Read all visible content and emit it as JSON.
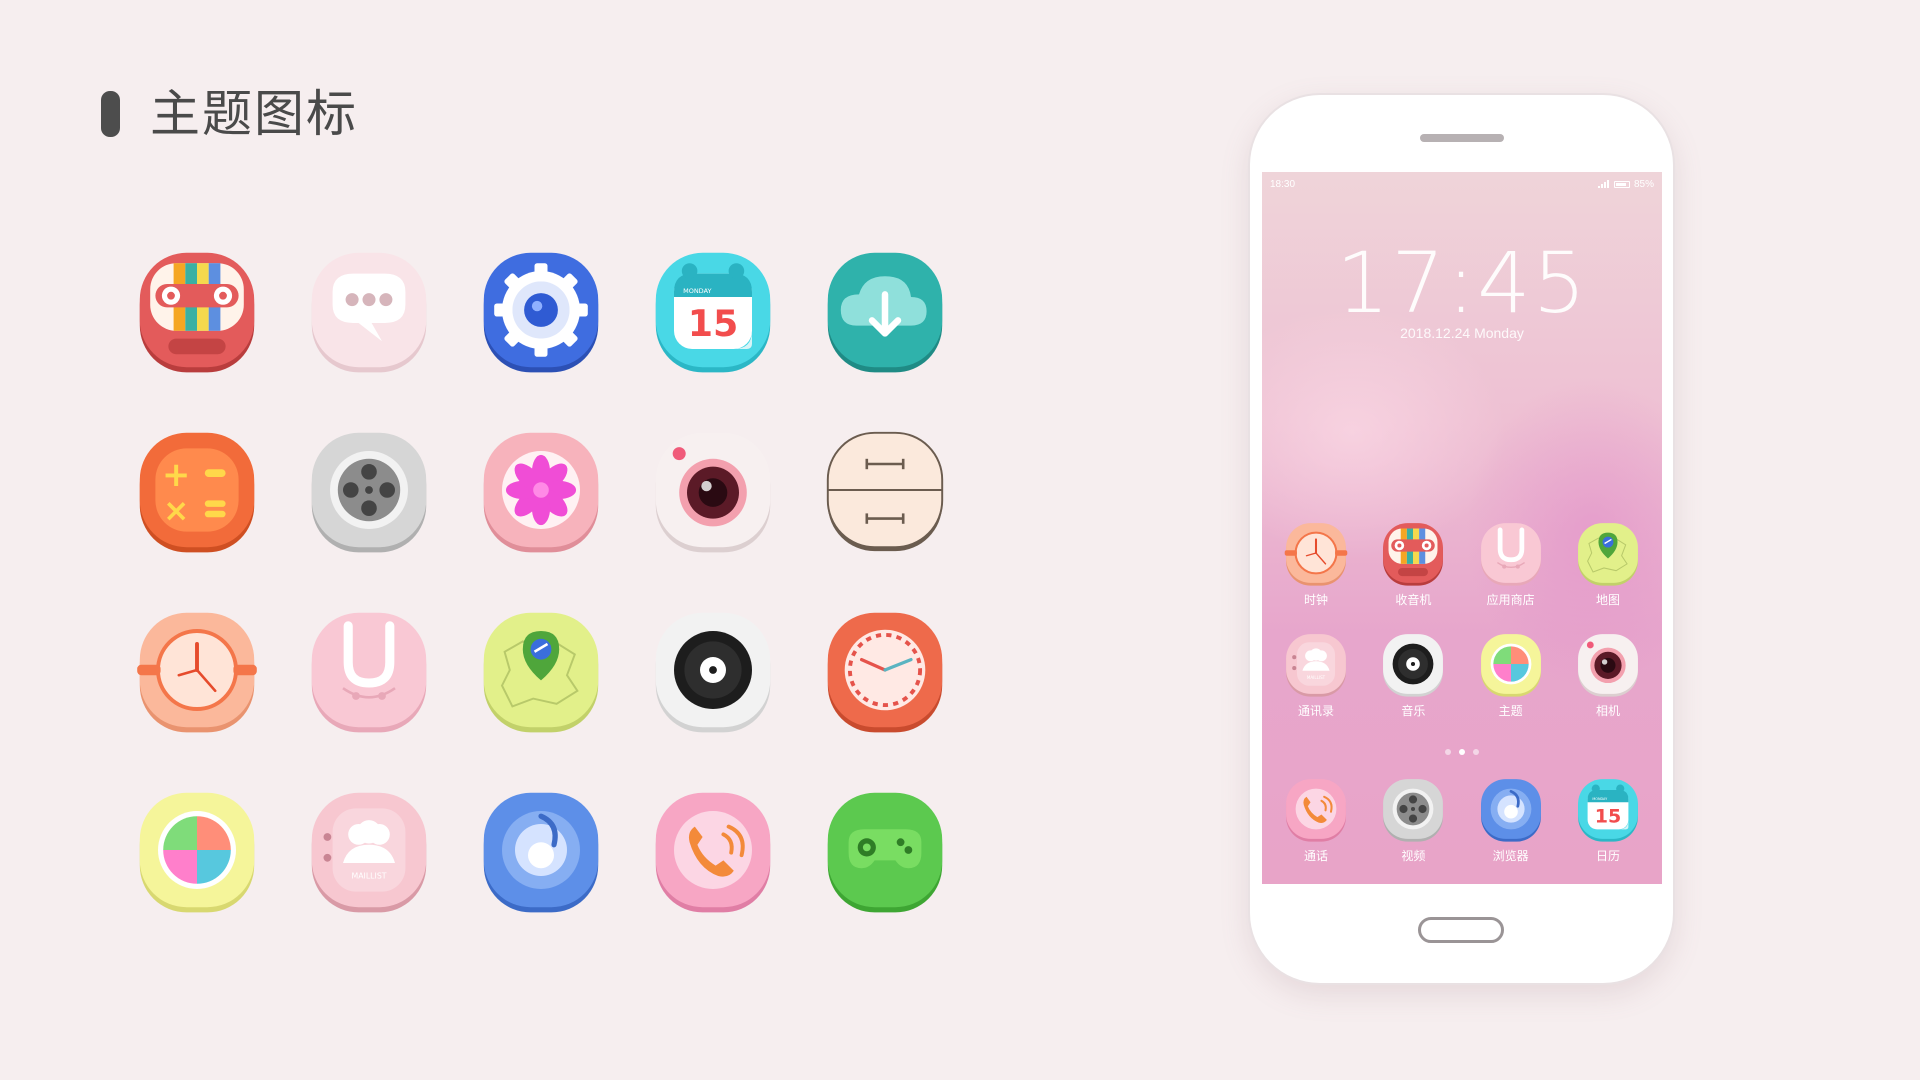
{
  "header": {
    "title": "主题图标"
  },
  "icon_grid": [
    "radio-icon",
    "messages-icon",
    "settings-icon",
    "calendar-icon",
    "cloud-download-icon",
    "calculator-icon",
    "video-icon",
    "gallery-icon",
    "camera-icon",
    "file-manager-icon",
    "clock-icon",
    "app-store-icon",
    "map-icon",
    "music-icon",
    "alarm-icon",
    "theme-icon",
    "contacts-icon",
    "browser-icon",
    "phone-call-icon",
    "game-icon"
  ],
  "calendar_icon": {
    "month_label": "MONDAY",
    "day": "15"
  },
  "contacts_icon": {
    "label": "MAILLIST"
  },
  "phone": {
    "status": {
      "time": "18:30",
      "battery": "85%"
    },
    "lock_time": "17:45",
    "lock_date": "2018.12.24  Monday",
    "page_dots": [
      false,
      true,
      false
    ],
    "rows": [
      [
        {
          "icon": "clock-icon",
          "label": "时钟"
        },
        {
          "icon": "radio-icon",
          "label": "收音机"
        },
        {
          "icon": "app-store-icon",
          "label": "应用商店"
        },
        {
          "icon": "map-icon",
          "label": "地图"
        }
      ],
      [
        {
          "icon": "contacts-icon",
          "label": "通讯录"
        },
        {
          "icon": "music-icon",
          "label": "音乐"
        },
        {
          "icon": "theme-icon",
          "label": "主题"
        },
        {
          "icon": "camera-icon",
          "label": "相机"
        }
      ]
    ],
    "dock": [
      {
        "icon": "phone-call-icon",
        "label": "通话"
      },
      {
        "icon": "video-icon",
        "label": "视频"
      },
      {
        "icon": "browser-icon",
        "label": "浏览器"
      },
      {
        "icon": "calendar-icon",
        "label": "日历"
      }
    ]
  },
  "colors": {
    "background": "#f6eeef",
    "title_text": "#4a4a4a",
    "screen_pink": "#e8a4c8"
  }
}
